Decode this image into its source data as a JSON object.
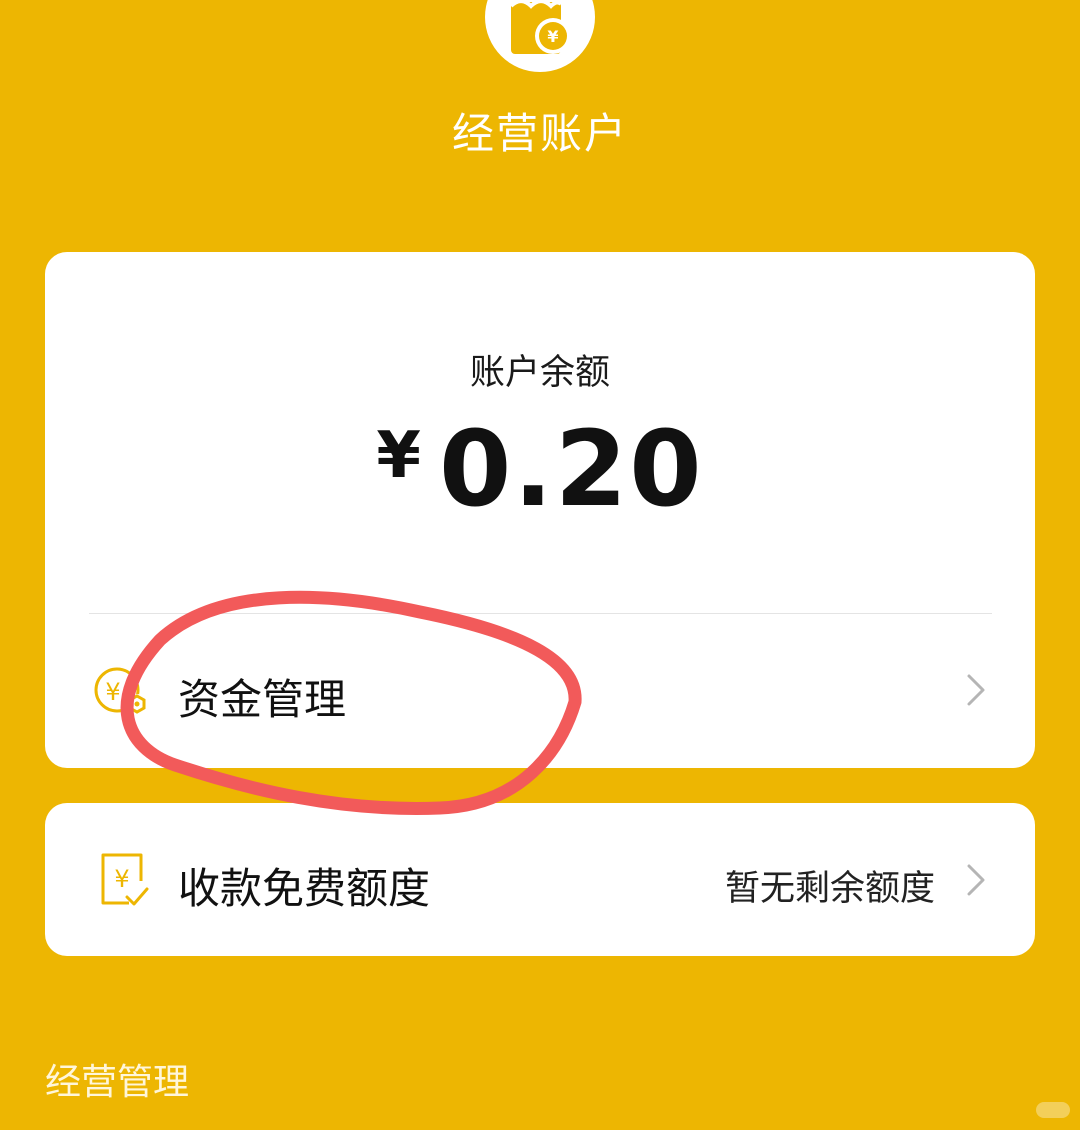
{
  "header": {
    "title": "经营账户",
    "logo_icon": "wallet-yuan-icon"
  },
  "balance": {
    "label": "账户余额",
    "currency_symbol": "¥",
    "amount": "0.20"
  },
  "fund_management": {
    "label": "资金管理",
    "icon": "yuan-coin-gear-icon"
  },
  "free_quota": {
    "label": "收款免费额度",
    "value": "暂无剩余额度",
    "icon": "yuan-receipt-check-icon"
  },
  "section": {
    "title": "经营管理"
  },
  "colors": {
    "background": "#EDB602",
    "card": "#FFFFFF",
    "icon_accent": "#EDB602",
    "annotation_stroke": "#F25A5A"
  }
}
